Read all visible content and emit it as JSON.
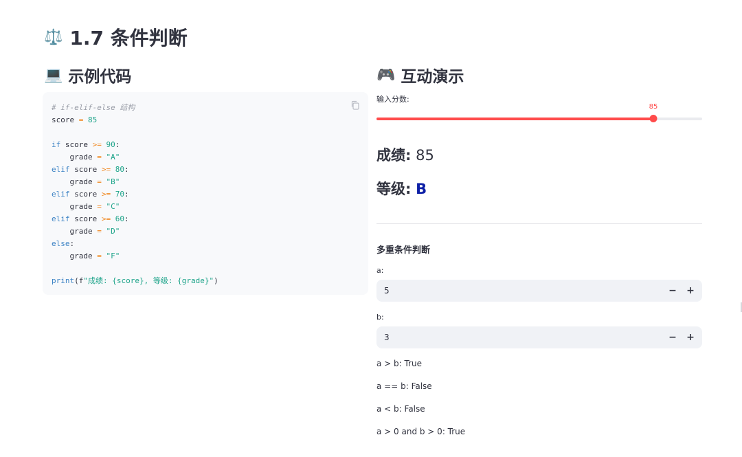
{
  "page": {
    "icon": "scales-icon",
    "title": "1.7 条件判断"
  },
  "left": {
    "icon": "laptop-icon",
    "title": "示例代码"
  },
  "code": {
    "lines": [
      "# if-elif-else 结构",
      "score = 85",
      "",
      "if score >= 90:",
      "    grade = \"A\"",
      "elif score >= 80:",
      "    grade = \"B\"",
      "elif score >= 70:",
      "    grade = \"C\"",
      "elif score >= 60:",
      "    grade = \"D\"",
      "else:",
      "    grade = \"F\"",
      "",
      "print(f\"成绩: {score}, 等级: {grade}\")"
    ],
    "copy_icon": "copy-icon"
  },
  "right": {
    "icon": "gamepad-icon",
    "title": "互动演示",
    "slider": {
      "label": "输入分数:",
      "value": 85,
      "min": 0,
      "max": 100,
      "color": "#ff4b4b"
    },
    "score_label": "成绩:",
    "score_value": "85",
    "grade_label": "等级:",
    "grade_value": "B",
    "grade_color": "#0d1fa6",
    "multi": {
      "heading": "多重条件判断",
      "a_label": "a:",
      "a_value": "5",
      "b_label": "b:",
      "b_value": "3",
      "minus": "−",
      "plus": "+",
      "results": [
        "a > b: True",
        "a == b: False",
        "a < b: False",
        "a > 0 and b > 0: True"
      ]
    }
  }
}
